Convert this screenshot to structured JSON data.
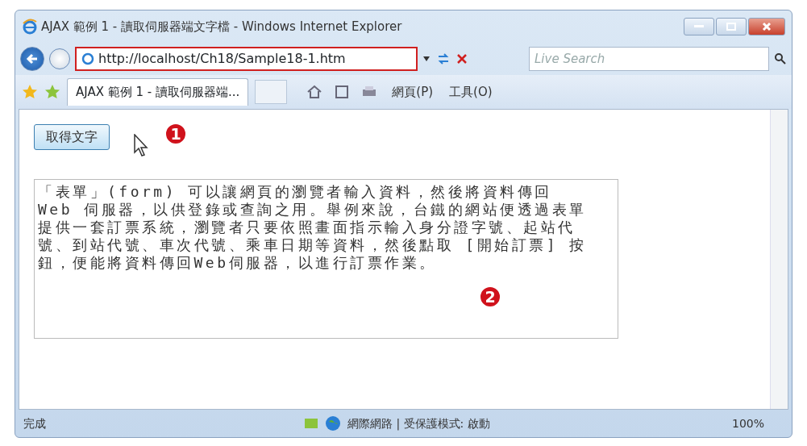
{
  "window": {
    "title": "AJAX 範例 1 - 讀取伺服器端文字檔 - Windows Internet Explorer"
  },
  "address_bar": {
    "url": "http://localhost/Ch18/Sample18-1.htm",
    "highlighted": true
  },
  "search": {
    "placeholder": "Live Search"
  },
  "tabs": [
    {
      "label": "AJAX 範例 1 - 讀取伺服器端...",
      "selected": true
    }
  ],
  "toolbar": [
    {
      "label": "網頁(P)"
    },
    {
      "label": "工具(O)"
    }
  ],
  "page": {
    "button": "取得文字",
    "text": "「表單」(form) 可以讓網頁的瀏覽者輸入資料，然後將資料傳回 Web 伺服器，以供登錄或查詢之用。舉例來說，台鐵的網站便透過表單提供一套訂票系統，瀏覽者只要依照畫面指示輸入身分證字號、起站代號、到站代號、車次代號、乘車日期等資料，然後點取 [開始訂票] 按鈕，便能將資料傳回Web伺服器，以進行訂票作業。"
  },
  "callouts": [
    "1",
    "2"
  ],
  "status_bar": {
    "text": "完成",
    "zone": "網際網路 | 受保護模式: 啟動",
    "zoom": "100%"
  }
}
